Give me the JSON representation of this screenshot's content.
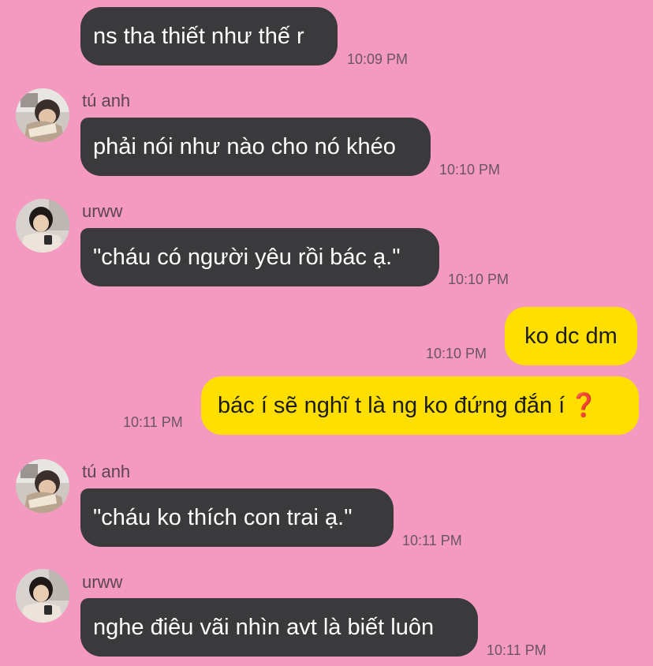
{
  "messages": [
    {
      "id": "m1",
      "direction": "in",
      "sender": "",
      "text": "ns tha thiết như thế r",
      "time": "10:09 PM"
    },
    {
      "id": "m2",
      "direction": "in",
      "sender": "tú anh",
      "avatar": "avatar-tu-anh",
      "text": "phải nói như nào cho nó khéo",
      "time": "10:10 PM"
    },
    {
      "id": "m3",
      "direction": "in",
      "sender": "urww",
      "avatar": "avatar-urww",
      "text": "\"cháu có người yêu rồi bác ạ.\"",
      "time": "10:10 PM"
    },
    {
      "id": "m4",
      "direction": "out",
      "text": "ko dc dm",
      "time": "10:10 PM"
    },
    {
      "id": "m5",
      "direction": "out",
      "text": "bác í sẽ nghĩ t là ng ko đứng đắn í",
      "emoji": "❓",
      "time": "10:11 PM"
    },
    {
      "id": "m6",
      "direction": "in",
      "sender": "tú anh",
      "avatar": "avatar-tu-anh",
      "text": "\"cháu ko thích con trai ạ.\"",
      "time": "10:11 PM"
    },
    {
      "id": "m7",
      "direction": "in",
      "sender": "urww",
      "avatar": "avatar-urww",
      "text": "nghe điêu vãi nhìn avt là biết luôn",
      "time": "10:11 PM"
    }
  ],
  "colors": {
    "background": "#f49ac1",
    "incoming_bubble": "#3a3a3c",
    "outgoing_bubble": "#fedf00",
    "timestamp": "#6a5560",
    "emoji_red": "#d9262c"
  }
}
